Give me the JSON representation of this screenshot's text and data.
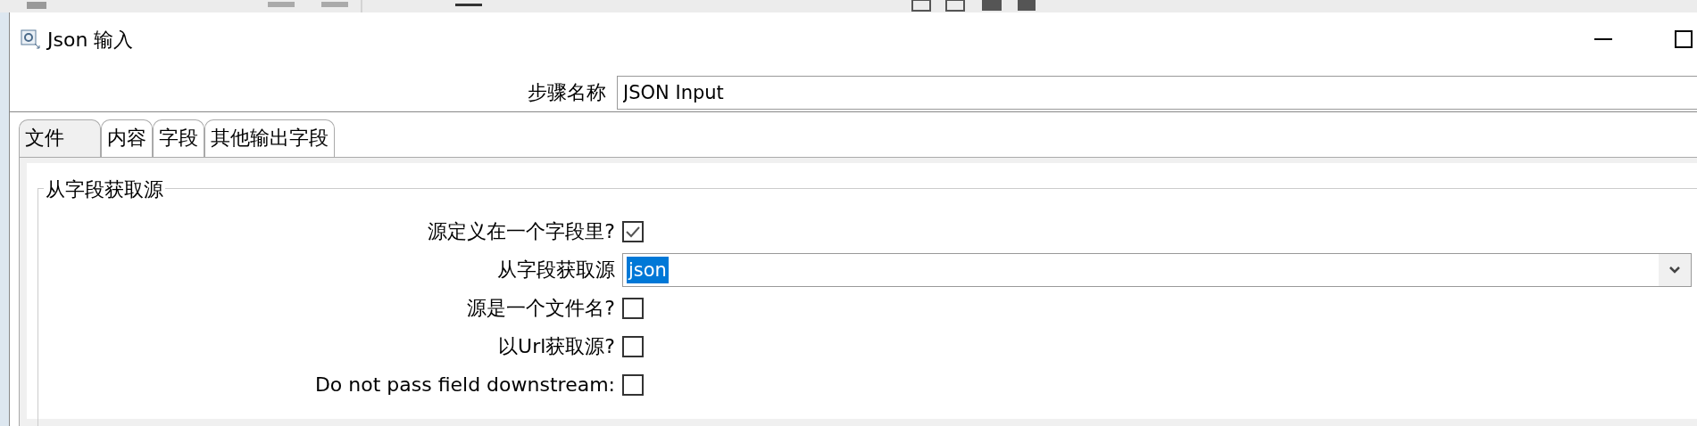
{
  "window": {
    "title": "Json 输入"
  },
  "step_name": {
    "label": "步骤名称",
    "value": "JSON Input"
  },
  "tabs": [
    {
      "label": "文件",
      "selected": true
    },
    {
      "label": "内容",
      "selected": false
    },
    {
      "label": "字段",
      "selected": false
    },
    {
      "label": "其他输出字段",
      "selected": false
    }
  ],
  "group": {
    "title": "从字段获取源",
    "rows": [
      {
        "kind": "checkbox",
        "label": "源定义在一个字段里?",
        "checked": true
      },
      {
        "kind": "dropdown",
        "label": "从字段获取源",
        "value": "json",
        "text_selected": true
      },
      {
        "kind": "checkbox",
        "label": "源是一个文件名?",
        "checked": false
      },
      {
        "kind": "checkbox",
        "label": "以Url获取源?",
        "checked": false
      },
      {
        "kind": "checkbox",
        "label": "Do not pass field downstream:",
        "checked": false
      }
    ]
  }
}
